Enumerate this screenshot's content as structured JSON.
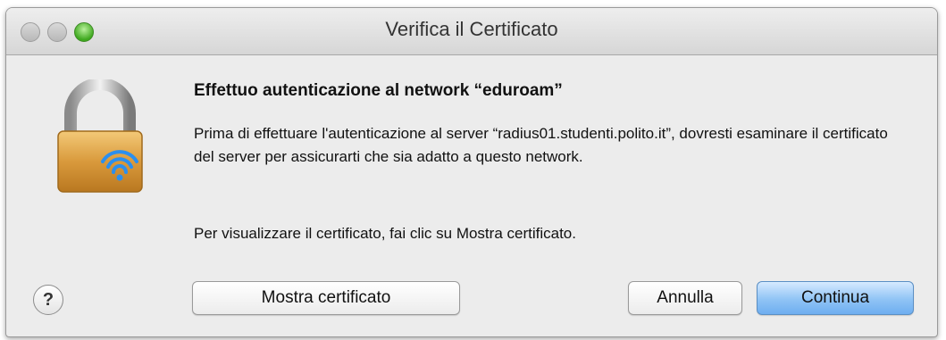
{
  "window": {
    "title": "Verifica il Certificato"
  },
  "icon": {
    "name": "lock-wifi-icon"
  },
  "dialog": {
    "heading": "Effettuo autenticazione al network “eduroam”",
    "message_1": "Prima di effettuare l'autenticazione al server “radius01.studenti.polito.it”, dovresti esaminare il certificato del server per assicurarti che sia adatto a questo network.",
    "message_2": "Per visualizzare il certificato, fai clic su Mostra certificato."
  },
  "buttons": {
    "help": "?",
    "show_certificate": "Mostra certificato",
    "cancel": "Annulla",
    "continue": "Continua"
  },
  "colors": {
    "default_button": "#8fc3f5",
    "window_bg": "#ececec"
  }
}
